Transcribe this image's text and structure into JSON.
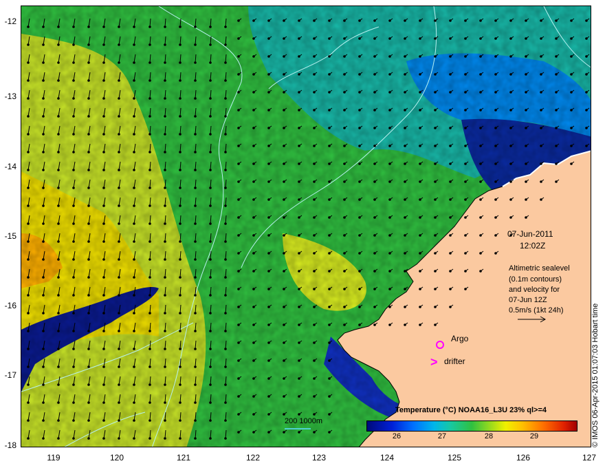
{
  "map": {
    "lat_labels": [
      "-12",
      "-13",
      "-14",
      "-15",
      "-16",
      "-17",
      "-18"
    ],
    "lon_labels": [
      "119",
      "120",
      "121",
      "122",
      "123",
      "124",
      "125",
      "126",
      "127"
    ],
    "date": "07-Jun-2011",
    "time": "12:02Z",
    "info_lines": [
      "Altimetric sealevel",
      "(0.1m contours)",
      "and velocity for",
      "07-Jun 12Z",
      "0.5m/s (1kt 24h)"
    ],
    "argo_label": "Argo",
    "drifter_label": "drifter",
    "drifter_symbol": ">",
    "scale_label": "200  1000m",
    "credit": "© IMOS 06-Apr-2015 01:07:03 Hobart time",
    "colors": {
      "land": "#fbc9a0",
      "ocean_warm": "#f0f000",
      "ocean_mid": "#30c040",
      "ocean_cool": "#00b6ea",
      "ocean_cold": "#000a7a",
      "marker": "#ff00ff",
      "contour": "#b8f0f0"
    }
  },
  "legend": {
    "title": "Temperature (°C) NOAA16_L3U 23% ql>=4",
    "ticks": [
      "26",
      "27",
      "28",
      "29"
    ]
  }
}
